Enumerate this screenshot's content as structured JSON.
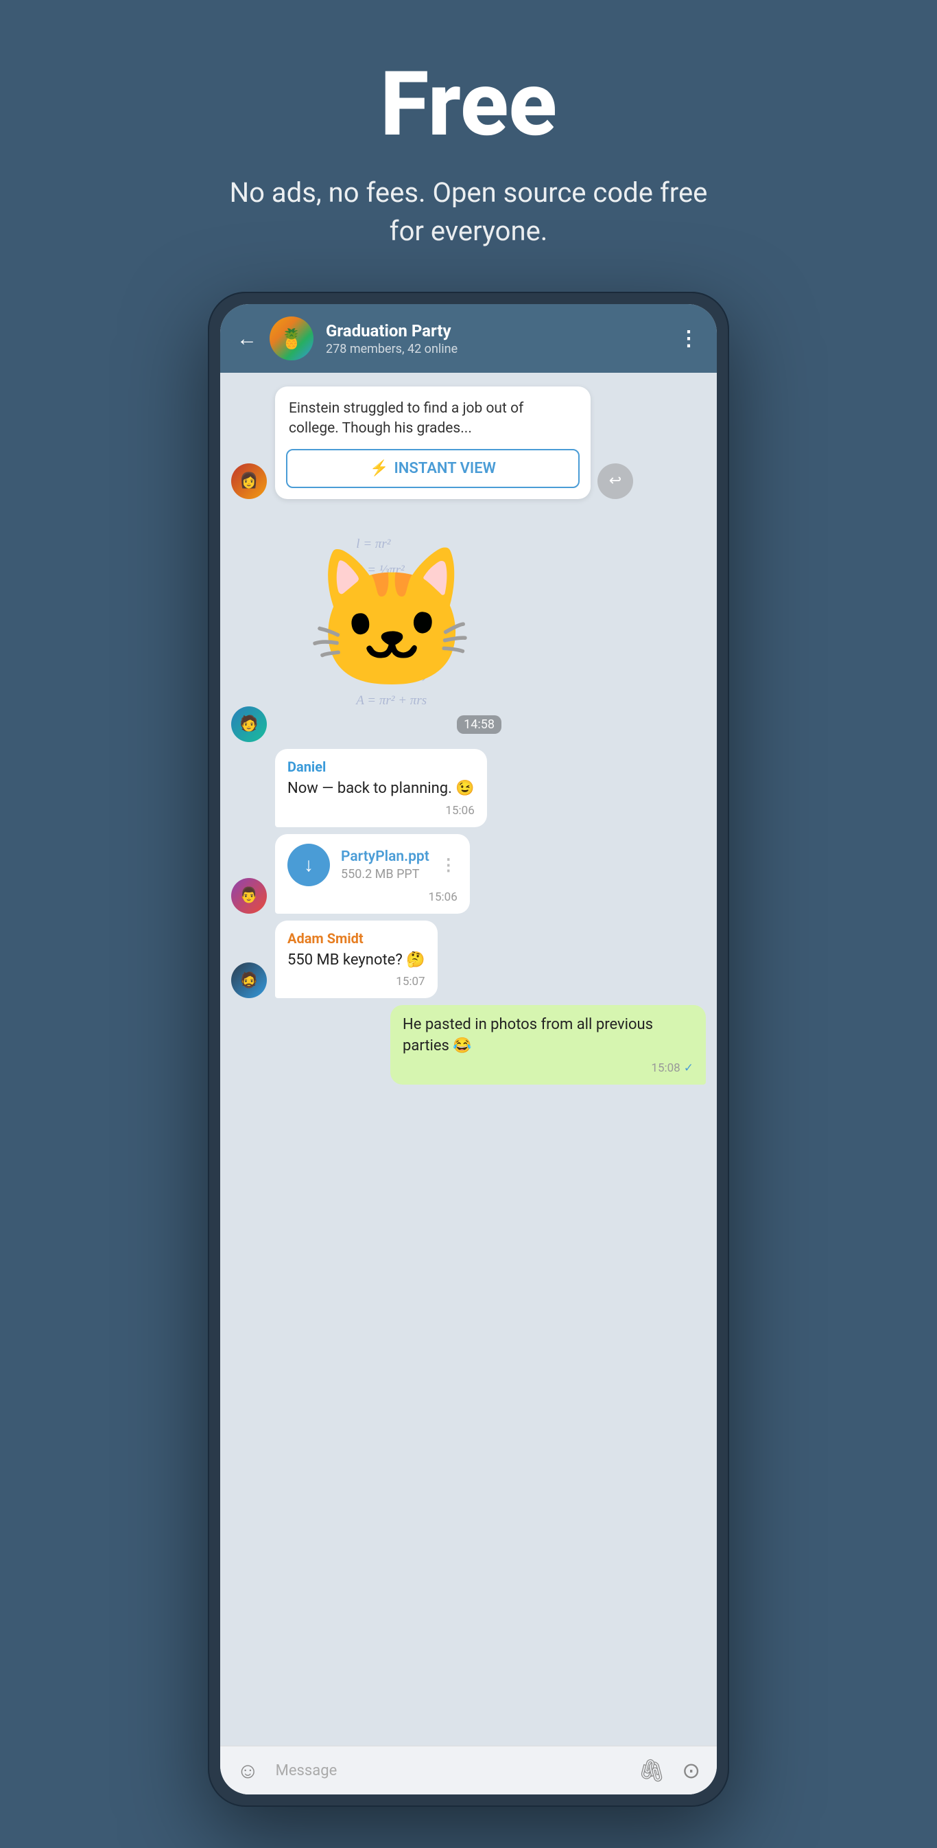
{
  "hero": {
    "title": "Free",
    "subtitle": "No ads, no fees. Open source code free for everyone."
  },
  "chat_header": {
    "group_name": "Graduation Party",
    "group_status": "278 members, 42 online",
    "avatar_emoji": "🍍"
  },
  "messages": {
    "article_excerpt": "Einstein struggled to find a job out of college. Though his grades...",
    "instant_view_label": "INSTANT VIEW",
    "instant_view_icon": "⚡",
    "sticker_time": "14:58",
    "daniel_name": "Daniel",
    "daniel_text": "Now — back to planning. 😉",
    "daniel_time": "15:06",
    "file_name": "PartyPlan.ppt",
    "file_size": "550.2 MB PPT",
    "file_time": "15:06",
    "adam_name": "Adam Smidt",
    "adam_text": "550 MB keynote? 🤔",
    "adam_time": "15:07",
    "own_text": "He pasted in photos from all previous parties 😂",
    "own_time": "15:08",
    "forward_icon": "↩",
    "input_placeholder": "Message",
    "emoji_icon": "☺",
    "attach_icon": "🖇",
    "camera_icon": "⊙"
  },
  "colors": {
    "header_bg": "#476a84",
    "body_bg": "#dce3ea",
    "brand_blue": "#4a9cd6",
    "bubble_green": "#d6f5b0",
    "page_bg": "#3d5a73"
  }
}
